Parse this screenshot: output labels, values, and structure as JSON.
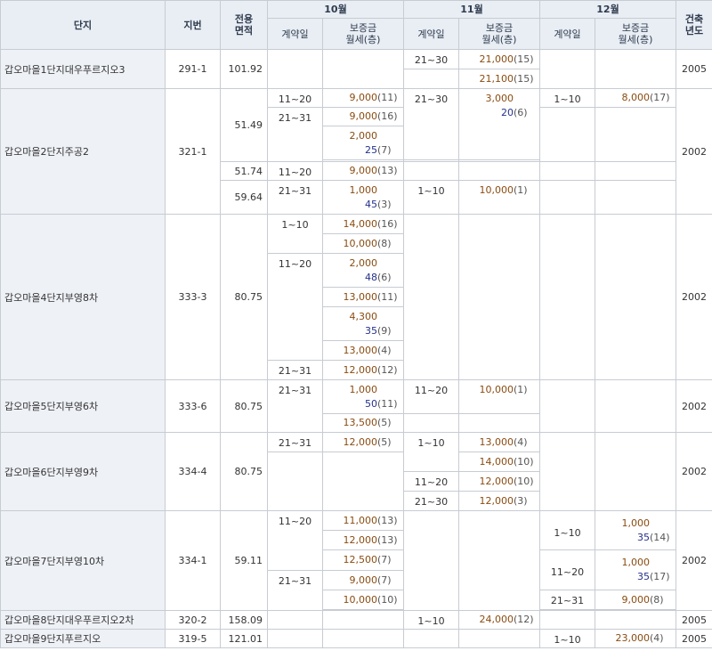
{
  "headers": {
    "complex": "단지",
    "lot": "지번",
    "area": "전용\n면적",
    "year": "건축\n년도",
    "months": [
      "10월",
      "11월",
      "12월"
    ],
    "contract_day": "계약일",
    "deposit_rent": "보증금\n월세(층)"
  },
  "rows": {
    "r1": {
      "name": "갑오마을1단지대우푸르지오3",
      "lot": "291-1",
      "area": "101.92",
      "year": "2005",
      "n_day": "21~30",
      "n_a": {
        "dep": "21,000",
        "floor": "(15)"
      },
      "n_b": {
        "dep": "21,100",
        "floor": "(15)"
      }
    },
    "r2": {
      "name": "갑오마을2단지주공2",
      "lot": "321-1",
      "area1": "51.49",
      "area2": "51.74",
      "area3": "59.64",
      "year": "2002",
      "o_d1": "11~20",
      "o_e1": {
        "dep": "9,000",
        "floor": "(11)"
      },
      "o_d2": "21~31",
      "o_e2": {
        "dep": "9,000",
        "floor": "(16)"
      },
      "o_e3": {
        "dep": "2,000",
        "rent": "25",
        "floor": "(7)"
      },
      "n_d1": "21~30",
      "n_e1": {
        "dep": "3,000",
        "rent": "20",
        "floor": "(6)"
      },
      "d_d1": "1~10",
      "d_e1": {
        "dep": "8,000",
        "floor": "(17)"
      },
      "o_d4": "11~20",
      "o_e4": {
        "dep": "9,000",
        "floor": "(13)"
      },
      "o_d5": "21~31",
      "o_e5": {
        "dep": "1,000",
        "rent": "45",
        "floor": "(3)"
      },
      "n_d5": "1~10",
      "n_e5": {
        "dep": "10,000",
        "floor": "(1)"
      }
    },
    "r4": {
      "name": "갑오마을4단지부영8차",
      "lot": "333-3",
      "area": "80.75",
      "year": "2002",
      "o_d1": "1~10",
      "o_e1": {
        "dep": "14,000",
        "floor": "(16)"
      },
      "o_e2": {
        "dep": "10,000",
        "floor": "(8)"
      },
      "o_d3": "11~20",
      "o_e3": {
        "dep": "2,000",
        "rent": "48",
        "floor": "(6)"
      },
      "o_e4": {
        "dep": "13,000",
        "floor": "(11)"
      },
      "o_e5": {
        "dep": "4,300",
        "rent": "35",
        "floor": "(9)"
      },
      "o_e6": {
        "dep": "13,000",
        "floor": "(4)"
      },
      "o_d7": "21~31",
      "o_e7": {
        "dep": "12,000",
        "floor": "(12)"
      }
    },
    "r5": {
      "name": "갑오마을5단지부영6차",
      "lot": "333-6",
      "area": "80.75",
      "year": "2002",
      "o_d1": "21~31",
      "o_e1": {
        "dep": "1,000",
        "rent": "50",
        "floor": "(11)"
      },
      "o_e2": {
        "dep": "13,500",
        "floor": "(5)"
      },
      "n_d1": "11~20",
      "n_e1": {
        "dep": "10,000",
        "floor": "(1)"
      }
    },
    "r6": {
      "name": "갑오마을6단지부영9차",
      "lot": "334-4",
      "area": "80.75",
      "year": "2002",
      "o_d1": "21~31",
      "o_e1": {
        "dep": "12,000",
        "floor": "(5)"
      },
      "n_d1": "1~10",
      "n_e1": {
        "dep": "13,000",
        "floor": "(4)"
      },
      "n_e2": {
        "dep": "14,000",
        "floor": "(10)"
      },
      "n_d3": "11~20",
      "n_e3": {
        "dep": "12,000",
        "floor": "(10)"
      },
      "n_d4": "21~30",
      "n_e4": {
        "dep": "12,000",
        "floor": "(3)"
      }
    },
    "r7": {
      "name": "갑오마을7단지부영10차",
      "lot": "334-1",
      "area": "59.11",
      "year": "2002",
      "o_d1": "11~20",
      "o_e1": {
        "dep": "11,000",
        "floor": "(13)"
      },
      "o_e2": {
        "dep": "12,000",
        "floor": "(13)"
      },
      "o_e3": {
        "dep": "12,500",
        "floor": "(7)"
      },
      "o_d4": "21~31",
      "o_e4": {
        "dep": "9,000",
        "floor": "(7)"
      },
      "o_e5": {
        "dep": "10,000",
        "floor": "(10)"
      },
      "d_d1": "1~10",
      "d_e1": {
        "dep": "1,000",
        "rent": "35",
        "floor": "(14)"
      },
      "d_d2": "11~20",
      "d_e2": {
        "dep": "1,000",
        "rent": "35",
        "floor": "(17)"
      },
      "d_d3": "21~31",
      "d_e3": {
        "dep": "9,000",
        "floor": "(8)"
      }
    },
    "r8": {
      "name": "갑오마을8단지대우푸르지오2차",
      "lot": "320-2",
      "area": "158.09",
      "year": "2005",
      "n_d1": "1~10",
      "n_e1": {
        "dep": "24,000",
        "floor": "(12)"
      }
    },
    "r9": {
      "name": "갑오마을9단지푸르지오",
      "lot": "319-5",
      "area": "121.01",
      "year": "2005",
      "d_d1": "1~10",
      "d_e1": {
        "dep": "23,000",
        "floor": "(4)"
      }
    }
  }
}
